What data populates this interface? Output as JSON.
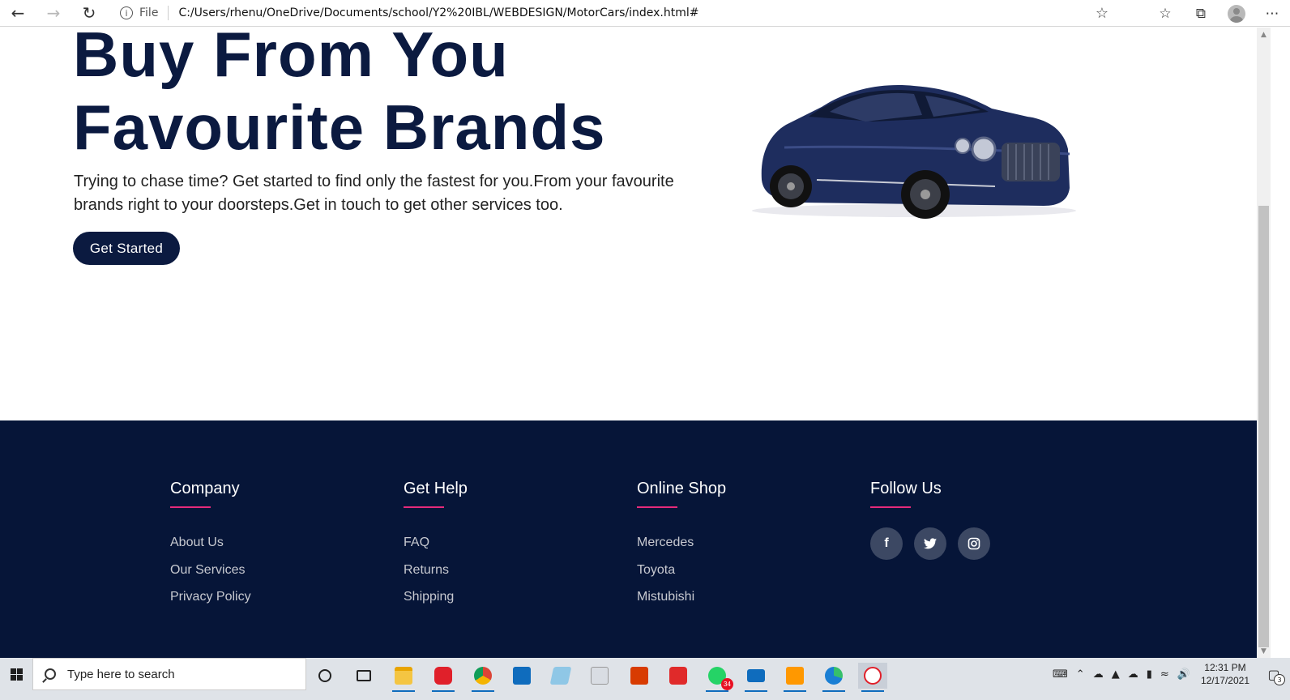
{
  "browser": {
    "file_label": "File",
    "url": "C:/Users/rhenu/OneDrive/Documents/school/Y2%20IBL/WEBDESIGN/MotorCars/index.html#"
  },
  "hero": {
    "title_line1": "Buy From You",
    "title_line2": "Favourite Brands",
    "text_line1": "Trying to chase time? Get started to find only the fastest for you.From your favourite",
    "text_line2": "brands right to your doorsteps.Get in touch to get other services too.",
    "cta_label": "Get Started",
    "image_icon": "car-image"
  },
  "footer": {
    "columns": [
      {
        "title": "Company",
        "links": [
          "About Us",
          "Our Services",
          "Privacy Policy"
        ]
      },
      {
        "title": "Get Help",
        "links": [
          "FAQ",
          "Returns",
          "Shipping"
        ]
      },
      {
        "title": "Online Shop",
        "links": [
          "Mercedes",
          "Toyota",
          "Mistubishi"
        ]
      },
      {
        "title": "Follow Us",
        "social": [
          "facebook-icon",
          "twitter-icon",
          "instagram-icon"
        ]
      }
    ],
    "accent_color": "#e52a7b",
    "background_color": "#061538"
  },
  "taskbar": {
    "search_placeholder": "Type here to search",
    "time": "12:31 PM",
    "date": "12/17/2021",
    "whatsapp_badge": "34",
    "notification_count": "3"
  },
  "colors": {
    "brand": "#0b1a40"
  }
}
